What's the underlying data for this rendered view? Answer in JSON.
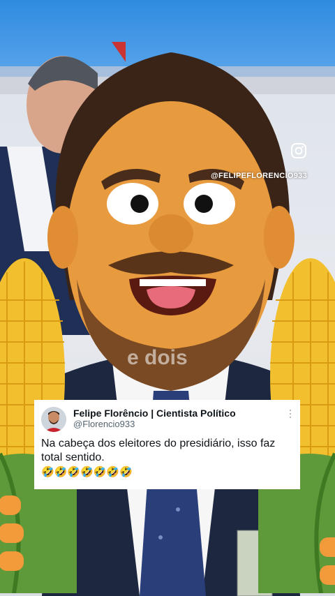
{
  "overlay": {
    "instagram_handle": "@FELIPEFLORENCIO933",
    "watermark": "e dois"
  },
  "post": {
    "author_name": "Felipe Florêncio | Cientista Político",
    "author_handle": "@Florencio933",
    "text": "Na cabeça dos eleitores do presidiário, isso faz total sentido.",
    "emojis": "🤣🤣🤣🤣🤣🤣🤣"
  },
  "icons": {
    "instagram": "instagram-icon",
    "more": "more-options-icon"
  },
  "colors": {
    "puppet_skin": "#e79a3e",
    "corn_kernel": "#f2c02e",
    "husk": "#5e9a3a",
    "sky_blue": "#2f8be0"
  }
}
